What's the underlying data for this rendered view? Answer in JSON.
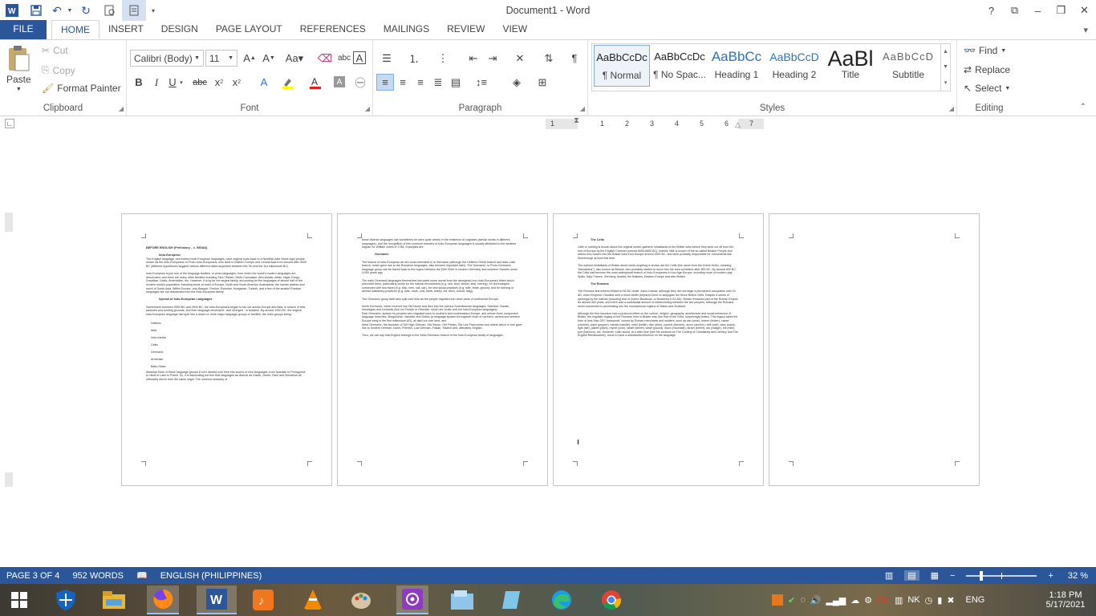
{
  "window": {
    "title": "Document1 - Word"
  },
  "tabs": [
    "FILE",
    "HOME",
    "INSERT",
    "DESIGN",
    "PAGE LAYOUT",
    "REFERENCES",
    "MAILINGS",
    "REVIEW",
    "VIEW"
  ],
  "clipboard": {
    "paste": "Paste",
    "cut": "Cut",
    "copy": "Copy",
    "format_painter": "Format Painter",
    "label": "Clipboard"
  },
  "font": {
    "name": "Calibri (Body)",
    "size": "11",
    "label": "Font"
  },
  "paragraph": {
    "label": "Paragraph"
  },
  "styles": {
    "items": [
      {
        "preview": "AaBbCcDc",
        "name": "¶ Normal"
      },
      {
        "preview": "AaBbCcDc",
        "name": "¶ No Spac..."
      },
      {
        "preview": "AaBbCc",
        "name": "Heading 1"
      },
      {
        "preview": "AaBbCcD",
        "name": "Heading 2"
      },
      {
        "preview": "AaBl",
        "name": "Title"
      },
      {
        "preview": "AaBbCcD",
        "name": "Subtitle"
      }
    ],
    "label": "Styles"
  },
  "editing": {
    "find": "Find",
    "replace": "Replace",
    "select": "Select",
    "label": "Editing"
  },
  "ruler": {
    "marks": [
      "1",
      "1",
      "2",
      "3",
      "4",
      "5",
      "6",
      "7"
    ]
  },
  "pages": [
    {
      "title": "BEFORE ENGLISH (Prehistory – c. 550AD)",
      "h1": "Indo-European",
      "p1": "The English language, and indeed most European languages, have original roots back to a Neolithic (late Stone Age) people known as the Indo-Europeans or Proto-Indo-Europeans, who lived in Eastern Europe and Central Asia from around after 5000 BC (different hypotheses suggest various different dates anywhere between the 7th and the 3rd millennium BC).",
      "p2": "Indo-European is just one of the language families, or proto-languages, from which the world's modern languages are descended, and there are many other families including Sino-Tibetan, North Caucasian, Afro-Asiatic, Altaic, Niger-Congo, Dravidian, Uralic, Amerindian, etc. However, it is by far the largest family, accounting for the languages of almost half of the modern world's population, including those of most of Europe, North and South America, Australasia, the Iranian plateau and much of South Asia. Within Europe, only Basque, Finnish, Estonian, Hungarian, Turkish, and a few of the smaller Russian languages are not descended from the Indo-European family.",
      "h2": "Spread of Indo-European Languages",
      "p3": "Somewhere between 3500 BC and 2500 BC, the Indo-Europeans began to fan out across Europe and Asia, in search of new pastures and hunting grounds, and their language developed - and diverged - in isolation. By around 1000 BC, the original Indo-European language had split into a dozen or more major language groups or families, the main groups being:",
      "list": [
        "Hellenic",
        "Italic",
        "Indo-Iranian",
        "Celtic",
        "Germanic",
        "Armenian",
        "Balto-Slavic"
      ],
      "p4": "Albanian Each of these language groups in turn divided over time into scores of new languages, from Swedish to Portuguese to Hindi to Latin to Polish. So, it is astounding but true that languages as diverse as Gaelic, Greek, Farsi and Sinhalese all ultimately derive from the same origin. The common ancestry of"
    },
    {
      "p0": "these diverse languages can sometimes be seen quite clearly in the existence of cognates (similar words in different languages), and the recognition of this common ancestry of Indo-European languages is usually attributed to the amateur linguist Sir William Jones in 1786. Examples are:",
      "h1": "Germanic",
      "p1": "The branch of Indo-European we are most interested in is Germanic (although the Hellenic-Greek branch and Italic-Latin branch, which gave rise to the Romance languages, also became important later). The Germanic, or Proto-Germanic, language group can be traced back to the region between the Elbe River in modern Germany and southern Sweden some 3,000 years ago.",
      "p2": "The early Germanic languages themselves borrowed some words from the aboriginal (non-Indo-European) tribes which preceded them, particularly words for the natural environment (e.g. sea, land, strand, seal, herring), for technologies connected with sea travel (e.g. ship, keel, sail, oar), for new social practices (e.g. wife, bride, groom); and for farming or animal husbandry practices (e.g. oats, mare, cow, lamb, sheep, kid, bitch, hound, stag).",
      "p3": "The Germanic group itself also split over time as the people migrated into other parts of continental Europe:",
      "p4": "North Germanic, which evolved into Old Norse and then into the various Scandinavian languages, Swedish, Danish, Norwegian and Icelandic (but not Finnish or Estonian, which are Uralic and not Indo-European languages);",
      "p5": "East Germanic, spoken by peoples who migrated back to southern and southeastern Europe, and whose three component language branches, Burgundian, Vandalic and Gothic (a language spoken throughout much of northern, central and western Europe early in the first millennium AD), all died out over time; and",
      "p6": "West Germanic, the ancestor of Old High German, Old Saxon, Old Frisian, Old Low Franconian and others which in turn gave rise to modern German, Dutch, Flemish, Low German, Frisian, Yiddish and, ultimately, English.",
      "p7": "Thus, we can say that English belongs to the West Germanic branch of the Indo-European family of languages."
    },
    {
      "h1": "The Celts",
      "p1": "Little or nothing is known about the original hunter-gatherer inhabitants of the British Isles before they were cut off from the rest of Europe by the English Channel (around 6000-6500 BC). Indeed, little is known of the so-called Beaker People and others who moved into the British Isles from Europe around 2500 BC, and were probably responsible for monuments like Stonehenge around this time.",
      "p2": "The earliest inhabitants of Britain about which anything is known are the Celts (the name from the Greek Keltoi, meaning \"barbarians\"), also known as Britons, who probably started to move into the area sometime after 800 BC. By around 600 BC, the Celts had become the most widespread branch of Indo-Europeans in Iron Age Europe, including much of modern-day Spain, Italy, France, Germany, Austria, the Balkans, Eastern Europe and also Britain.",
      "h2": "The Romans",
      "p3": "The Romans first entered Britain in 55 BC under Julius Caesar, although they did not begin a permanent occupation until 43 AD, when Emperor Claudius sent a much better prepared force to subjugate the fierce British Celts. Despite a series of uprisings by the natives (including that of Queen Boudicca, or Boadicea in 61 AD), Britain remained part of the Roman Empire for almost 400 years, and there was a substantial amount of interbreeding between the two peoples, although the Romans never succeeded in penetrating into the mountainous regions of Wales and Scotland.",
      "p4": "Although the first incursion had a profound effect on the culture, religion, geography, architecture and social behaviour of Britain, the linguistic legacy of the Romans' time in Britain was, like that of the Celts, surprisingly limited. This legacy takes the form of less than 200 \"loanwords\" coined by Roman merchants and soldiers, such as win (wine), butere (butter), caese (cheese), piper (pepper), candel (candle), cetel (kettle), disc (dish), cycene (kitchen), ancor (anchor), belt (belt), sacc (sack), tigle (tile), plante (plant), mynet (coin), straet (street), weall (pound), mure (mountain), straet (street), wic (village), mil (mile), port (harbour), etc. However, Latin would, at a later time (see the sections on The Coming of Christianity and Literacy and The English Renaissance), come to have a substantial influence on the language."
    }
  ],
  "status": {
    "page": "PAGE 3 OF 4",
    "words": "952 WORDS",
    "language": "ENGLISH (PHILIPPINES)",
    "zoom": "32 %"
  },
  "clock": {
    "time": "1:18 PM",
    "date": "5/17/2021",
    "lang": "ENG"
  }
}
